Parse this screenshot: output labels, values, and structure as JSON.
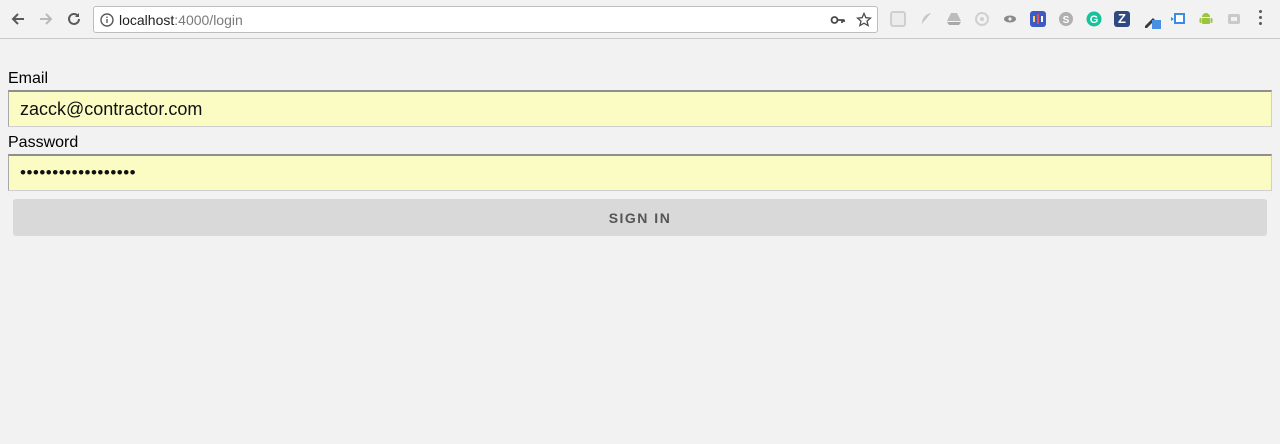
{
  "browser": {
    "url_host": "localhost",
    "url_path": ":4000/login",
    "extension_icons": [
      {
        "name": "grid-ext-icon",
        "color": "#bdbdbd"
      },
      {
        "name": "feather-ext-icon",
        "color": "#c7c7c7"
      },
      {
        "name": "drive-ext-icon",
        "color": "#bcbcbc"
      },
      {
        "name": "target-ext-icon",
        "color": "#d0d0d0"
      },
      {
        "name": "eye-ext-icon",
        "color": "#8a8a8a"
      },
      {
        "name": "columns-ext-icon",
        "color": "#3b5bc7"
      },
      {
        "name": "skype-ext-icon",
        "color": "#a9a9a9"
      },
      {
        "name": "grammarly-ext-icon",
        "color": "#15c39a"
      },
      {
        "name": "z-ext-icon",
        "color": "#2f4a80"
      },
      {
        "name": "eyedropper-ext-icon",
        "color": "#3a3a3a"
      },
      {
        "name": "calendar-ext-icon",
        "color": "#3d8be8"
      },
      {
        "name": "android-ext-icon",
        "color": "#9bc53d"
      },
      {
        "name": "cast-ext-icon",
        "color": "#c9c9c9"
      }
    ],
    "z_letter": "Z"
  },
  "login": {
    "email_label": "Email",
    "email_value": "zacck@contractor.com",
    "password_label": "Password",
    "password_value": "••••••••••••••••••",
    "submit_label": "SIGN IN"
  },
  "colors": {
    "autofill_bg": "#fbfcc3",
    "button_bg": "#d9d9d9",
    "page_bg": "#f2f2f2"
  }
}
